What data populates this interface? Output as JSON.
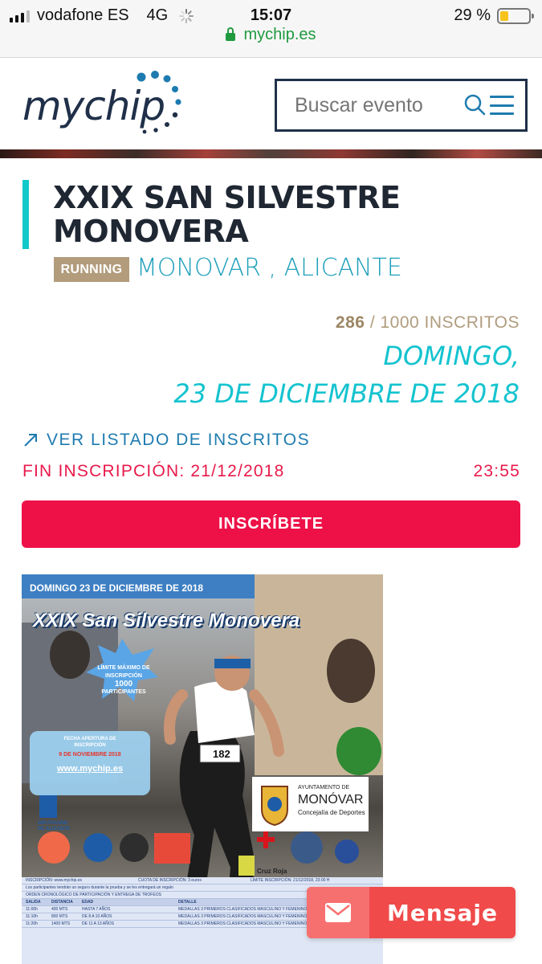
{
  "status_bar": {
    "carrier": "vodafone ES",
    "network": "4G",
    "time": "15:07",
    "battery": "29 %",
    "battery_level": 0.29,
    "url": "mychip.es",
    "url_color": "#1f9a3f"
  },
  "header": {
    "logo_text": "mychip",
    "search_placeholder": "Buscar evento",
    "icons": [
      "search-icon",
      "menu-icon"
    ],
    "brand_color": "#203049",
    "accent_color": "#1e7bb0"
  },
  "event": {
    "title": "XXIX SAN SILVESTRE MONOVERA",
    "sport": "RUNNING",
    "location": "MONOVAR , ALICANTE",
    "registered": "286",
    "capacity_text": "/ 1000 INSCRITOS",
    "date_line1": "DOMINGO,",
    "date_line2": "23 DE DICIEMBRE DE 2018",
    "list_link": "VER LISTADO DE INSCRITOS",
    "deadline_label": "FIN INSCRIPCIÓN: 21/12/2018",
    "deadline_time": "23:55",
    "register_button": "INSCRÍBETE",
    "colors": {
      "title_bar": "#12c9c9",
      "date": "#14c3cf",
      "deadline": "#e8194a",
      "button": "#ee1148",
      "badge": "#b29c7c"
    }
  },
  "poster": {
    "date": "DOMINGO 23 DE DICIEMBRE DE 2018",
    "title": "XXIX San Silvestre Monovera",
    "star_text": [
      "LÍMITE MÁXIMO DE",
      "INSCRIPCIÓN",
      "1000",
      "PARTICIPANTES"
    ],
    "bib_number": "182",
    "info_lines": [
      "FECHA APERTURA DE",
      "INSCRIPCIÓN",
      "9 DE NOVIEMBRE 2018",
      "www.mychip.es"
    ],
    "ayuntamiento": [
      "AYUNTAMENTO DE",
      "MONÓVAR",
      "Concejalía de Deportes"
    ],
    "diputacion": [
      "DIPUTACIÓN",
      "DE ALICANTE"
    ],
    "cruz_roja": "Cruz Roja",
    "table": {
      "top_line": [
        "INSCRIPCIÓN: www.mychip.es",
        "CUOTA DE INSCRIPCIÓN: 3 euros",
        "LÍMITE INSCRIPCIÓN: 21/12/2018, 23:00 H"
      ],
      "note": "Los participantes tendrán un seguro durante la prueba y se les entregará un regalo",
      "order_line": "ORDEN CRONOLÓGICO DE PARTICIPACIÓN Y ENTREGA DE TROFEOS",
      "headers": [
        "SALIDA",
        "DISTANCIA",
        "EDAD",
        "DETALLE"
      ],
      "rows": [
        [
          "11:00h",
          "400 MTS",
          "HASTA 7 AÑOS",
          "MEDALLAS 3 PRIMEROS CLASIFICADOS MASCULINO Y FEMENINO"
        ],
        [
          "11:10h",
          "800 MTS",
          "DE 8 A 10 AÑOS",
          "MEDALLAS 3 PRIMEROS CLASIFICADOS MASCULINO Y FEMENINO"
        ],
        [
          "11:20h",
          "1400 MTS",
          "DE 11 A 13 AÑOS",
          "MEDALLAS 3 PRIMEROS CLASIFICADOS MASCULINO Y FEMENINO"
        ]
      ]
    }
  },
  "floating": {
    "message_label": "Mensaje",
    "color": "#f04a4a"
  }
}
